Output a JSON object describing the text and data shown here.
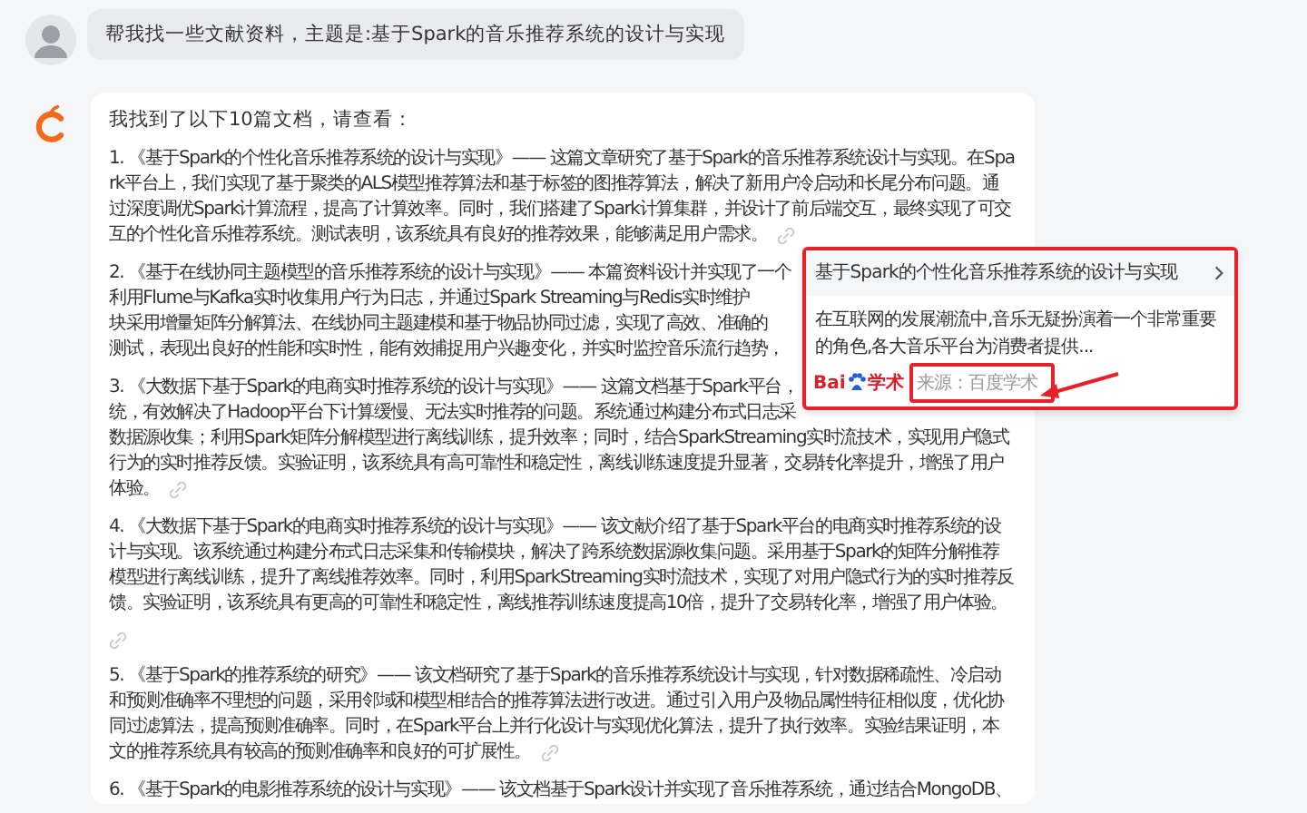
{
  "user_message": {
    "text": "帮我找一些文献资料，主题是:基于Spark的音乐推荐系统的设计与实现"
  },
  "assistant_message": {
    "intro": "我找到了以下10篇文档，请查看：",
    "items": [
      {
        "kind": "link_inline",
        "lines": [
          "1. 《基于Spark的个性化音乐推荐系统的设计与实现》—— 这篇文章研究了基于Spark的音乐推荐系统设计与实现。在Spa",
          "rk平台上，我们实现了基于聚类的ALS模型推荐算法和基于标签的图推荐算法，解决了新用户冷启动和长尾分布问题。通",
          "过深度调优Spark计算流程，提高了计算效率。同时，我们搭建了Spark计算集群，并设计了前后端交互，最终实现了可交",
          "互的个性化音乐推荐系统。测试表明，该系统具有良好的推荐效果，能够满足用户需求。"
        ]
      },
      {
        "kind": "plain",
        "lines": [
          "2. 《基于在线协同主题模型的音乐推荐系统的设计与实现》—— 本篇资料设计并实现了一个",
          "利用Flume与Kafka实时收集用户行为日志，并通过Spark Streaming与Redis实时维护",
          "块采用增量矩阵分解算法、在线协同主题建模和基于物品协同过滤，实现了高效、准确的",
          "测试，表现出良好的性能和实时性，能有效捕捉用户兴趣变化，并实时监控音乐流行趋势，"
        ]
      },
      {
        "kind": "link_inline",
        "lines": [
          "3. 《大数据下基于Spark的电商实时推荐系统的设计与实现》—— 这篇文档基于Spark平台，",
          "统，有效解决了Hadoop平台下计算缓慢、无法实时推荐的问题。系统通过构建分布式日志采",
          "数据源收集；利用Spark矩阵分解模型进行离线训练，提升效率；同时，结合SparkStreaming实时流技术，实现用户隐式",
          "行为的实时推荐反馈。实验证明，该系统具有高可靠性和稳定性，离线训练速度提升显著，交易转化率提升，增强了用户",
          "体验。"
        ]
      },
      {
        "kind": "link_own_line",
        "lines": [
          "4. 《大数据下基于Spark的电商实时推荐系统的设计与实现》—— 该文献介绍了基于Spark平台的电商实时推荐系统的设",
          "计与实现。该系统通过构建分布式日志采集和传输模块，解决了跨系统数据源收集问题。采用基于Spark的矩阵分解推荐",
          "模型进行离线训练，提升了离线推荐效率。同时，利用SparkStreaming实时流技术，实现了对用户隐式行为的实时推荐反",
          "馈。实验证明，该系统具有更高的可靠性和稳定性，离线推荐训练速度提高10倍，提升了交易转化率，增强了用户体验。"
        ]
      },
      {
        "kind": "link_inline",
        "lines": [
          "5. 《基于Spark的推荐系统的研究》—— 该文档研究了基于Spark的音乐推荐系统设计与实现，针对数据稀疏性、冷启动",
          "和预测准确率不理想的问题，采用邻域和模型相结合的推荐算法进行改进。通过引入用户及物品属性特征相似度，优化协",
          "同过滤算法，提高预测准确率。同时，在Spark平台上并行化设计与实现优化算法，提升了执行效率。实验结果证明，本",
          "文的推荐系统具有较高的预测准确率和良好的可扩展性。"
        ]
      },
      {
        "kind": "plain",
        "lines": [
          "6. 《基于Spark的电影推荐系统的设计与实现》—— 该文档基于Spark设计并实现了音乐推荐系统，通过结合MongoDB、"
        ]
      }
    ]
  },
  "popup": {
    "title": "基于Spark的个性化音乐推荐系统的设计与实现",
    "excerpt_lines": [
      "在互联网的发展潮流中,音乐无疑扮演着一个非常重要",
      "的角色,各大音乐平台为消费者提供..."
    ],
    "logo": {
      "latin": "Bai",
      "cjk": "学术"
    },
    "source": "来源：百度学术",
    "highlighted": true,
    "source_highlighted": true,
    "annotation_arrow": true
  }
}
